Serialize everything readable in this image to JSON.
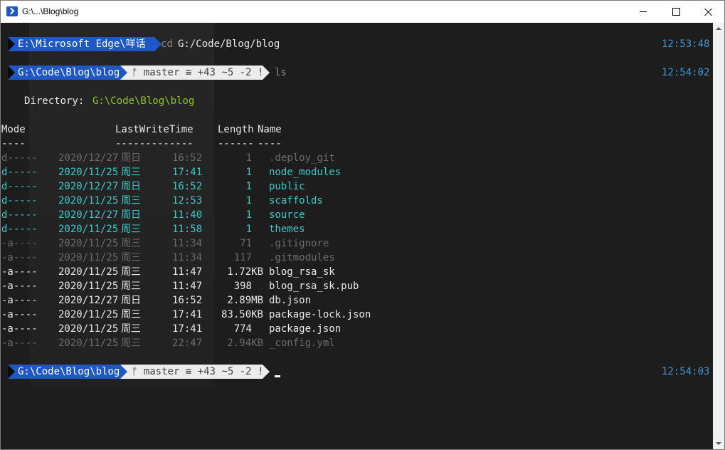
{
  "window": {
    "title": "G:\\...\\Blog\\blog"
  },
  "prompts": [
    {
      "path": "E:\\Microsoft Edge\\咩话",
      "cmd_name": "cd",
      "cmd_arg": "G:/Code/Blog/blog",
      "time": "12:53:48"
    },
    {
      "path": "G:\\Code\\Blog\\blog",
      "git": "ᚠ master ≡ +43 ~5 -2 !",
      "cmd_name": "ls",
      "time": "12:54:02"
    },
    {
      "path": "G:\\Code\\Blog\\blog",
      "git": "ᚠ master ≡ +43 ~5 -2 !",
      "time": "12:54:03"
    }
  ],
  "listing": {
    "directory_label": "Directory:",
    "directory_path": "G:\\Code\\Blog\\blog",
    "headers": {
      "mode": "Mode",
      "lastwrite": "LastWriteTime",
      "length": "Length",
      "name": "Name"
    },
    "underlines": {
      "mode": "----",
      "lastwrite": "-------------",
      "length": "------",
      "name": "----"
    },
    "rows": [
      {
        "mode": "d-----",
        "date": "2020/12/27",
        "day": "周日",
        "time": "16:52",
        "length": "1",
        "name": ".deploy_git",
        "style": "dim"
      },
      {
        "mode": "d-----",
        "date": "2020/11/25",
        "day": "周三",
        "time": "17:41",
        "length": "1",
        "name": "node_modules",
        "style": "dir"
      },
      {
        "mode": "d-----",
        "date": "2020/12/27",
        "day": "周日",
        "time": "16:52",
        "length": "1",
        "name": "public",
        "style": "dir"
      },
      {
        "mode": "d-----",
        "date": "2020/11/25",
        "day": "周三",
        "time": "12:53",
        "length": "1",
        "name": "scaffolds",
        "style": "dir"
      },
      {
        "mode": "d-----",
        "date": "2020/12/27",
        "day": "周日",
        "time": "11:40",
        "length": "1",
        "name": "source",
        "style": "dir"
      },
      {
        "mode": "d-----",
        "date": "2020/11/25",
        "day": "周三",
        "time": "11:58",
        "length": "1",
        "name": "themes",
        "style": "dir"
      },
      {
        "mode": "-a----",
        "date": "2020/11/25",
        "day": "周三",
        "time": "11:34",
        "length": "71",
        "name": ".gitignore",
        "style": "dim"
      },
      {
        "mode": "-a----",
        "date": "2020/11/25",
        "day": "周三",
        "time": "11:34",
        "length": "117",
        "name": ".gitmodules",
        "style": "dim"
      },
      {
        "mode": "-a----",
        "date": "2020/11/25",
        "day": "周三",
        "time": "11:47",
        "length": "1.72KB",
        "name": "blog_rsa_sk",
        "style": "file"
      },
      {
        "mode": "-a----",
        "date": "2020/11/25",
        "day": "周三",
        "time": "11:47",
        "length": "398",
        "name": "blog_rsa_sk.pub",
        "style": "file"
      },
      {
        "mode": "-a----",
        "date": "2020/12/27",
        "day": "周日",
        "time": "16:52",
        "length": "2.89MB",
        "name": "db.json",
        "style": "file"
      },
      {
        "mode": "-a----",
        "date": "2020/11/25",
        "day": "周三",
        "time": "17:41",
        "length": "83.50KB",
        "name": "package-lock.json",
        "style": "file"
      },
      {
        "mode": "-a----",
        "date": "2020/11/25",
        "day": "周三",
        "time": "17:41",
        "length": "774",
        "name": "package.json",
        "style": "file"
      },
      {
        "mode": "-a----",
        "date": "2020/11/25",
        "day": "周三",
        "time": "22:47",
        "length": "2.94KB",
        "name": "_config.yml",
        "style": "dim"
      }
    ]
  },
  "icons": {
    "app": "powershell-icon",
    "minimize": "minimize-icon",
    "maximize": "maximize-icon",
    "close": "close-icon"
  },
  "colors": {
    "path_segment": "#1f57c4",
    "git_segment": "#ececec",
    "time": "#3a96dd",
    "directory_path": "#8ac926",
    "directory_entry": "#3ec9c9",
    "hidden_entry": "#6b6b6b"
  }
}
